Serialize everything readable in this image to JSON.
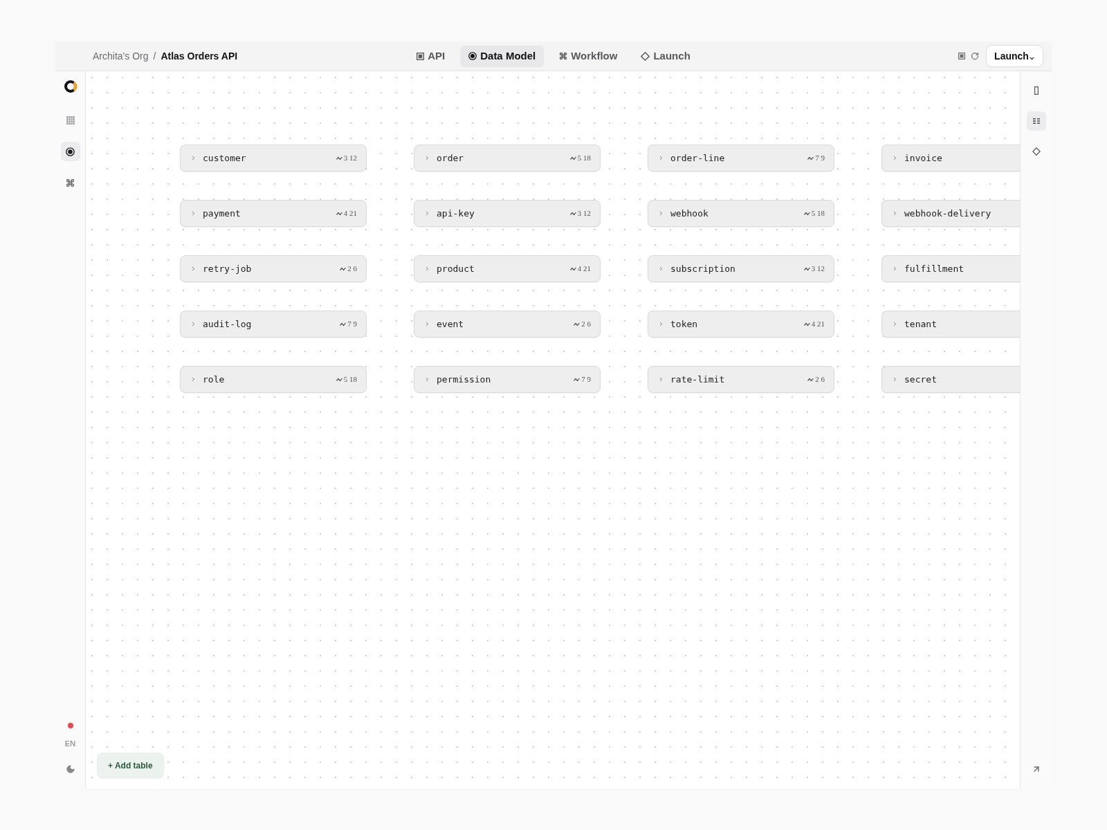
{
  "top_bar": {
    "breadcrumb": {
      "org": "Archita's Org",
      "separator": "/",
      "project": "Atlas Orders API"
    },
    "tabs": [
      {
        "label": "API",
        "selected": false
      },
      {
        "label": "Data Model",
        "selected": true
      },
      {
        "label": "Workflow",
        "selected": false
      },
      {
        "label": "Launch",
        "selected": false
      }
    ],
    "launch_button": {
      "label": "Launch"
    }
  },
  "left_rail": {
    "items": [
      {
        "selected": false
      },
      {
        "selected": true
      },
      {
        "selected": false
      }
    ],
    "language": "EN"
  },
  "right_rail": {
    "items": [
      {
        "selected": false
      },
      {
        "selected": true
      },
      {
        "selected": false
      }
    ]
  },
  "canvas": {
    "tables": [
      {
        "name": "customer",
        "count": "3 12",
        "expanded": false
      },
      {
        "name": "order",
        "count": "5 18",
        "expanded": false
      },
      {
        "name": "order-line",
        "count": "7 9",
        "expanded": false
      },
      {
        "name": "invoice",
        "expanded": false
      },
      {
        "name": "payment",
        "count": "4 21",
        "expanded": false
      },
      {
        "name": "api-key",
        "count": "3 12",
        "expanded": false
      },
      {
        "name": "webhook",
        "count": "5 18",
        "expanded": false
      },
      {
        "name": "webhook-delivery",
        "expanded": false
      },
      {
        "name": "retry-job",
        "count": "2 6",
        "expanded": false
      },
      {
        "name": "product",
        "count": "4 21",
        "expanded": false
      },
      {
        "name": "subscription",
        "count": "3 12",
        "expanded": false
      },
      {
        "name": "fulfillment",
        "expanded": false
      },
      {
        "name": "audit-log",
        "count": "7 9",
        "expanded": false
      },
      {
        "name": "event",
        "count": "2 6",
        "expanded": false
      },
      {
        "name": "token",
        "count": "4 21",
        "expanded": false
      },
      {
        "name": "tenant",
        "expanded": false
      },
      {
        "name": "role",
        "count": "5 18",
        "expanded": false
      },
      {
        "name": "permission",
        "count": "7 9",
        "expanded": false
      },
      {
        "name": "rate-limit",
        "count": "2 6",
        "expanded": false
      },
      {
        "name": "secret",
        "expanded": false
      }
    ],
    "add_button": {
      "label": "+ Add table"
    }
  }
}
